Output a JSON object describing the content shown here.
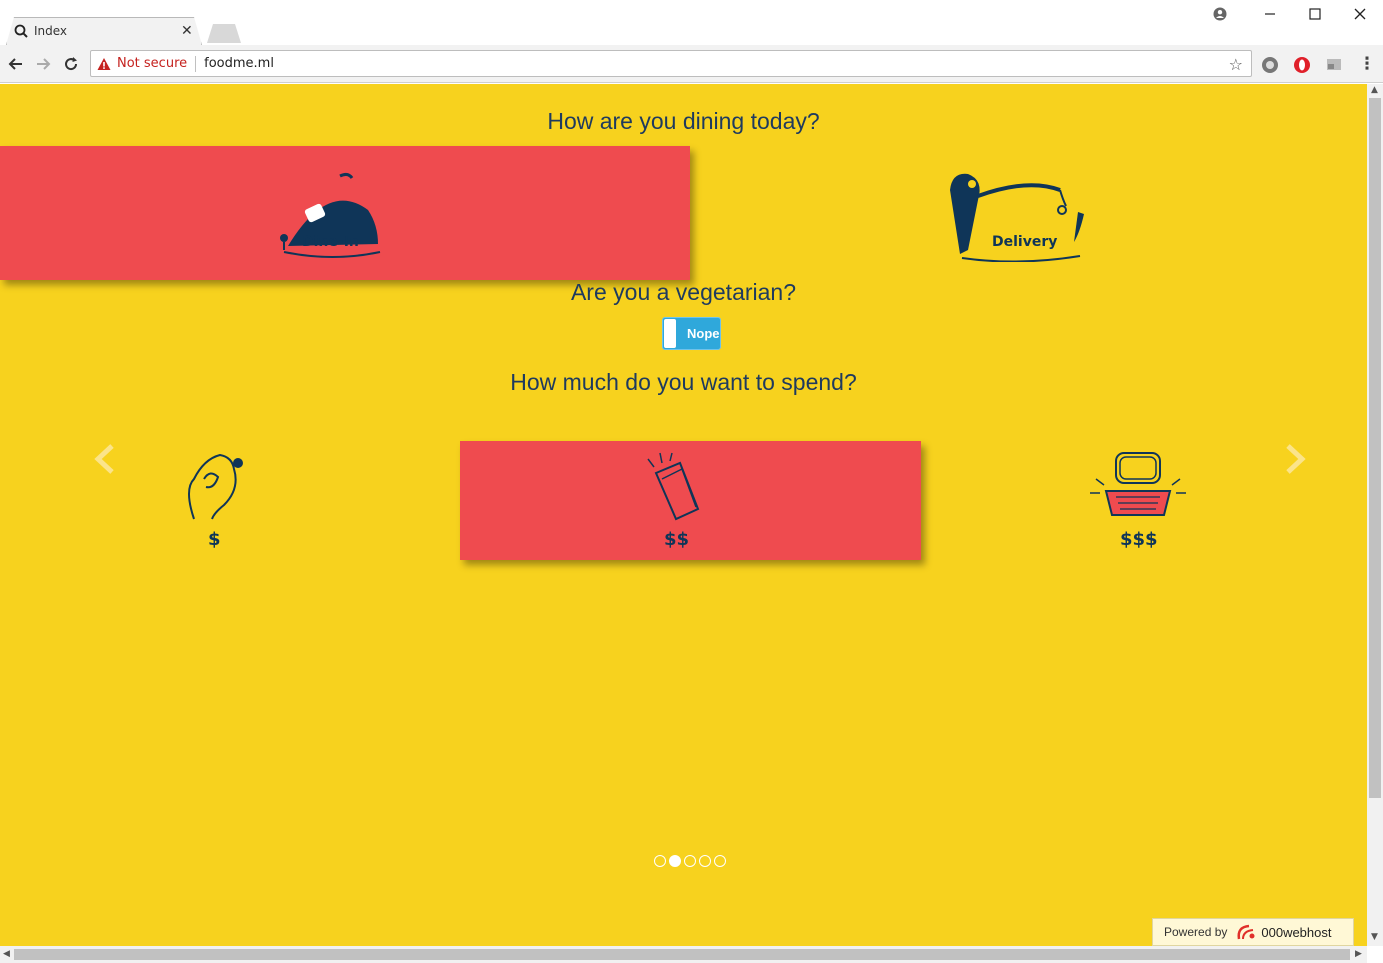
{
  "browser": {
    "tab_title": "Index",
    "not_secure": "Not secure",
    "url": "foodme.ml"
  },
  "page": {
    "q_dining": "How are you dining today?",
    "dine_in": "Dine-In",
    "delivery": "Delivery",
    "q_veg": "Are you a vegetarian?",
    "toggle_label": "Nope",
    "q_spend": "How much do you want to spend?",
    "price_low": "$",
    "price_mid": "$$",
    "price_high": "$$$",
    "slides": 5,
    "active_slide": 2
  },
  "footer": {
    "powered_by": "Powered by",
    "brand": "000webhost"
  },
  "colors": {
    "page_bg": "#f7d21e",
    "selected": "#ef4b4f",
    "ink": "#0f3558",
    "toggle": "#2fa8db"
  }
}
